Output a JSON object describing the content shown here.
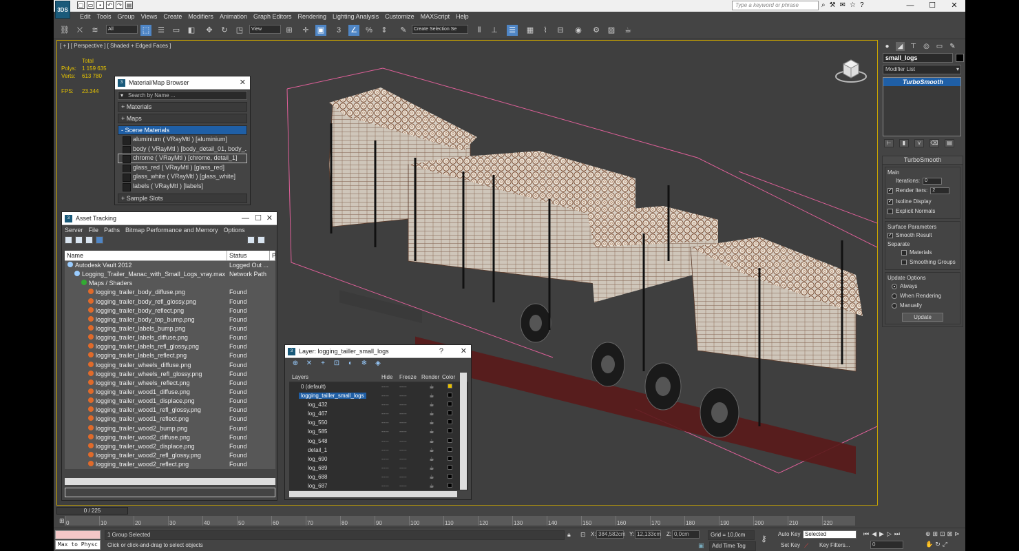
{
  "app": {
    "logo": "3DS"
  },
  "titlebar": {
    "search_placeholder": "Type a keyword or phrase",
    "minimize": "—",
    "maximize": "☐",
    "close": "✕"
  },
  "menu": [
    "Edit",
    "Tools",
    "Group",
    "Views",
    "Create",
    "Modifiers",
    "Animation",
    "Graph Editors",
    "Rendering",
    "Lighting Analysis",
    "Customize",
    "MAXScript",
    "Help"
  ],
  "toolbar": {
    "filter": "All",
    "ref_coord": "View",
    "snap_label": "3",
    "selection_set": "Create Selection Se"
  },
  "viewport": {
    "label": "[ + ] [ Perspective ] [ Shaded + Edged Faces ]",
    "stats_header": "Total",
    "polys_label": "Polys:",
    "polys_value": "1 159 635",
    "verts_label": "Verts:",
    "verts_value": "613 780",
    "fps_label": "FPS:",
    "fps_value": "23.344"
  },
  "material_browser": {
    "title": "Material/Map Browser",
    "search_placeholder": "Search by Name ...",
    "rollouts": [
      "+ Materials",
      "+ Maps",
      "- Scene Materials"
    ],
    "materials": [
      "aluminium ( VRayMtl ) [aluminium]",
      "body ( VRayMtl ) [body_detail_01, body_...",
      "chrome ( VRayMtl ) [chrome, detail_1]",
      "glass_red ( VRayMtl ) [glass_red]",
      "glass_white ( VRayMtl ) [glass_white]",
      "labels ( VRayMtl ) [labels]"
    ],
    "sample_slots": "+ Sample Slots"
  },
  "asset_tracking": {
    "title": "Asset Tracking",
    "menu": [
      "Server",
      "File",
      "Paths",
      "Bitmap Performance and Memory",
      "Options"
    ],
    "col_name": "Name",
    "col_status": "Status",
    "col_p": "P",
    "rows": [
      {
        "name": "Autodesk Vault 2012",
        "status": "Logged Out ...",
        "indent": 0
      },
      {
        "name": "Logging_Trailer_Manac_with_Small_Logs_vray.max",
        "status": "Network Path",
        "indent": 1
      },
      {
        "name": "Maps / Shaders",
        "status": "",
        "indent": 2
      },
      {
        "name": "logging_trailer_body_diffuse.png",
        "status": "Found",
        "indent": 3
      },
      {
        "name": "logging_trailer_body_refl_glossy.png",
        "status": "Found",
        "indent": 3
      },
      {
        "name": "logging_trailer_body_reflect.png",
        "status": "Found",
        "indent": 3
      },
      {
        "name": "logging_trailer_body_top_bump.png",
        "status": "Found",
        "indent": 3
      },
      {
        "name": "logging_trailer_labels_bump.png",
        "status": "Found",
        "indent": 3
      },
      {
        "name": "logging_trailer_labels_diffuse.png",
        "status": "Found",
        "indent": 3
      },
      {
        "name": "logging_trailer_labels_refl_glossy.png",
        "status": "Found",
        "indent": 3
      },
      {
        "name": "logging_trailer_labels_reflect.png",
        "status": "Found",
        "indent": 3
      },
      {
        "name": "logging_trailer_wheels_diffuse.png",
        "status": "Found",
        "indent": 3
      },
      {
        "name": "logging_trailer_wheels_refl_glossy.png",
        "status": "Found",
        "indent": 3
      },
      {
        "name": "logging_trailer_wheels_reflect.png",
        "status": "Found",
        "indent": 3
      },
      {
        "name": "logging_trailer_wood1_diffuse.png",
        "status": "Found",
        "indent": 3
      },
      {
        "name": "logging_trailer_wood1_displace.png",
        "status": "Found",
        "indent": 3
      },
      {
        "name": "logging_trailer_wood1_refl_glossy.png",
        "status": "Found",
        "indent": 3
      },
      {
        "name": "logging_trailer_wood1_reflect.png",
        "status": "Found",
        "indent": 3
      },
      {
        "name": "logging_trailer_wood2_bump.png",
        "status": "Found",
        "indent": 3
      },
      {
        "name": "logging_trailer_wood2_diffuse.png",
        "status": "Found",
        "indent": 3
      },
      {
        "name": "logging_trailer_wood2_displace.png",
        "status": "Found",
        "indent": 3
      },
      {
        "name": "logging_trailer_wood2_refl_glossy.png",
        "status": "Found",
        "indent": 3
      },
      {
        "name": "logging_trailer_wood2_reflect.png",
        "status": "Found",
        "indent": 3
      }
    ]
  },
  "layer_explorer": {
    "title": "Layer: logging_tailler_small_logs",
    "help": "?",
    "cols": [
      "Layers",
      "Hide",
      "Freeze",
      "Render",
      "Color"
    ],
    "rows": [
      {
        "name": "0 (default)",
        "color": "#e8c000",
        "indent": 1
      },
      {
        "name": "logging_tailler_small_logs",
        "color": "#000000",
        "indent": 1,
        "selected": true
      },
      {
        "name": "log_432",
        "color": "#000000",
        "indent": 2
      },
      {
        "name": "log_467",
        "color": "#000000",
        "indent": 2
      },
      {
        "name": "log_550",
        "color": "#000000",
        "indent": 2
      },
      {
        "name": "log_585",
        "color": "#000000",
        "indent": 2
      },
      {
        "name": "log_548",
        "color": "#000000",
        "indent": 2
      },
      {
        "name": "detail_1",
        "color": "#000000",
        "indent": 2
      },
      {
        "name": "log_690",
        "color": "#000000",
        "indent": 2
      },
      {
        "name": "log_689",
        "color": "#000000",
        "indent": 2
      },
      {
        "name": "log_688",
        "color": "#000000",
        "indent": 2
      },
      {
        "name": "log_687",
        "color": "#000000",
        "indent": 2
      }
    ],
    "dash": "----"
  },
  "command_panel": {
    "object_name": "small_logs",
    "modifier_list": "Modifier List",
    "stack_item": "TurboSmooth",
    "rollout_title": "TurboSmooth",
    "main_label": "Main",
    "iterations_label": "Iterations:",
    "iterations_value": "0",
    "render_iters_label": "Render Iters:",
    "render_iters_value": "2",
    "isoline_label": "Isoline Display",
    "explicit_label": "Explicit Normals",
    "surface_label": "Surface Parameters",
    "smooth_label": "Smooth Result",
    "separate_label": "Separate",
    "materials_label": "Materials",
    "smoothing_groups_label": "Smoothing Groups",
    "update_options_label": "Update Options",
    "always_label": "Always",
    "when_rendering_label": "When Rendering",
    "manually_label": "Manually",
    "update_button": "Update"
  },
  "timeline": {
    "frame": "0 / 225",
    "ticks": [
      "0",
      "10",
      "20",
      "30",
      "40",
      "50",
      "60",
      "70",
      "80",
      "90",
      "100",
      "110",
      "120",
      "130",
      "140",
      "150",
      "160",
      "170",
      "180",
      "190",
      "200",
      "210",
      "220"
    ]
  },
  "status": {
    "maxscript": "Max to Physc",
    "selected": "1 Group Selected",
    "prompt": "Click or click-and-drag to select objects",
    "x_label": "X:",
    "x_value": "384,582cm",
    "y_label": "Y:",
    "y_value": "12,133cm",
    "z_label": "Z:",
    "z_value": "0,0cm",
    "grid": "Grid = 10,0cm",
    "add_time_tag": "Add Time Tag",
    "auto_key": "Auto Key",
    "auto_key_value": "Selected",
    "set_key": "Set Key",
    "key_filters": "Key Filters...",
    "frame_value": "0"
  },
  "colors": {
    "accent": "#1f5fa6",
    "viewport_border": "#c8a400",
    "bbox": "#e0609a",
    "stats": "#e6c300"
  }
}
